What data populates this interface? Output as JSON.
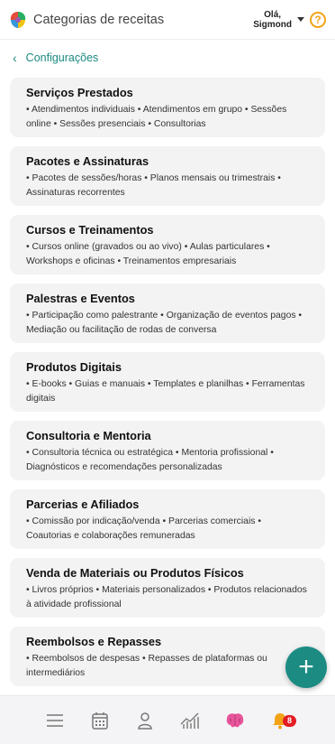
{
  "header": {
    "title": "Categorias de receitas",
    "user_line1": "Olá,",
    "user_line2": "Sigmond",
    "help_label": "?"
  },
  "breadcrumb": {
    "label": "Configurações"
  },
  "categories": [
    {
      "title": "Serviços Prestados",
      "desc": "• Atendimentos individuais • Atendimentos em grupo • Sessões online • Sessões presenciais • Consultorias"
    },
    {
      "title": "Pacotes e Assinaturas",
      "desc": "• Pacotes de sessões/horas • Planos mensais ou trimestrais • Assinaturas recorrentes"
    },
    {
      "title": "Cursos e Treinamentos",
      "desc": "• Cursos online (gravados ou ao vivo) • Aulas particulares • Workshops e oficinas • Treinamentos empresariais"
    },
    {
      "title": "Palestras e Eventos",
      "desc": "• Participação como palestrante • Organização de eventos pagos • Mediação ou facilitação de rodas de conversa"
    },
    {
      "title": "Produtos Digitais",
      "desc": "• E-books • Guias e manuais • Templates e planilhas • Ferramentas digitais"
    },
    {
      "title": "Consultoria e Mentoria",
      "desc": "• Consultoria técnica ou estratégica • Mentoria profissional • Diagnósticos e recomendações personalizadas"
    },
    {
      "title": "Parcerias e Afiliados",
      "desc": "• Comissão por indicação/venda • Parcerias comerciais • Coautorias e colaborações remuneradas"
    },
    {
      "title": "Venda de Materiais ou Produtos Físicos",
      "desc": "• Livros próprios • Materiais personalizados • Produtos relacionados à atividade profissional"
    },
    {
      "title": "Reembolsos e Repasses",
      "desc": "• Reembolsos de despesas • Repasses de plataformas ou intermediários"
    }
  ],
  "fab": {
    "label": "+"
  },
  "bottom_nav": {
    "items": [
      "menu-icon",
      "calendar-icon",
      "user-icon",
      "chart-icon",
      "brain-icon",
      "bell-icon"
    ],
    "notification_count": "8"
  },
  "colors": {
    "accent": "#1c8c83",
    "help": "#f2a316",
    "badge": "#e31b23"
  }
}
